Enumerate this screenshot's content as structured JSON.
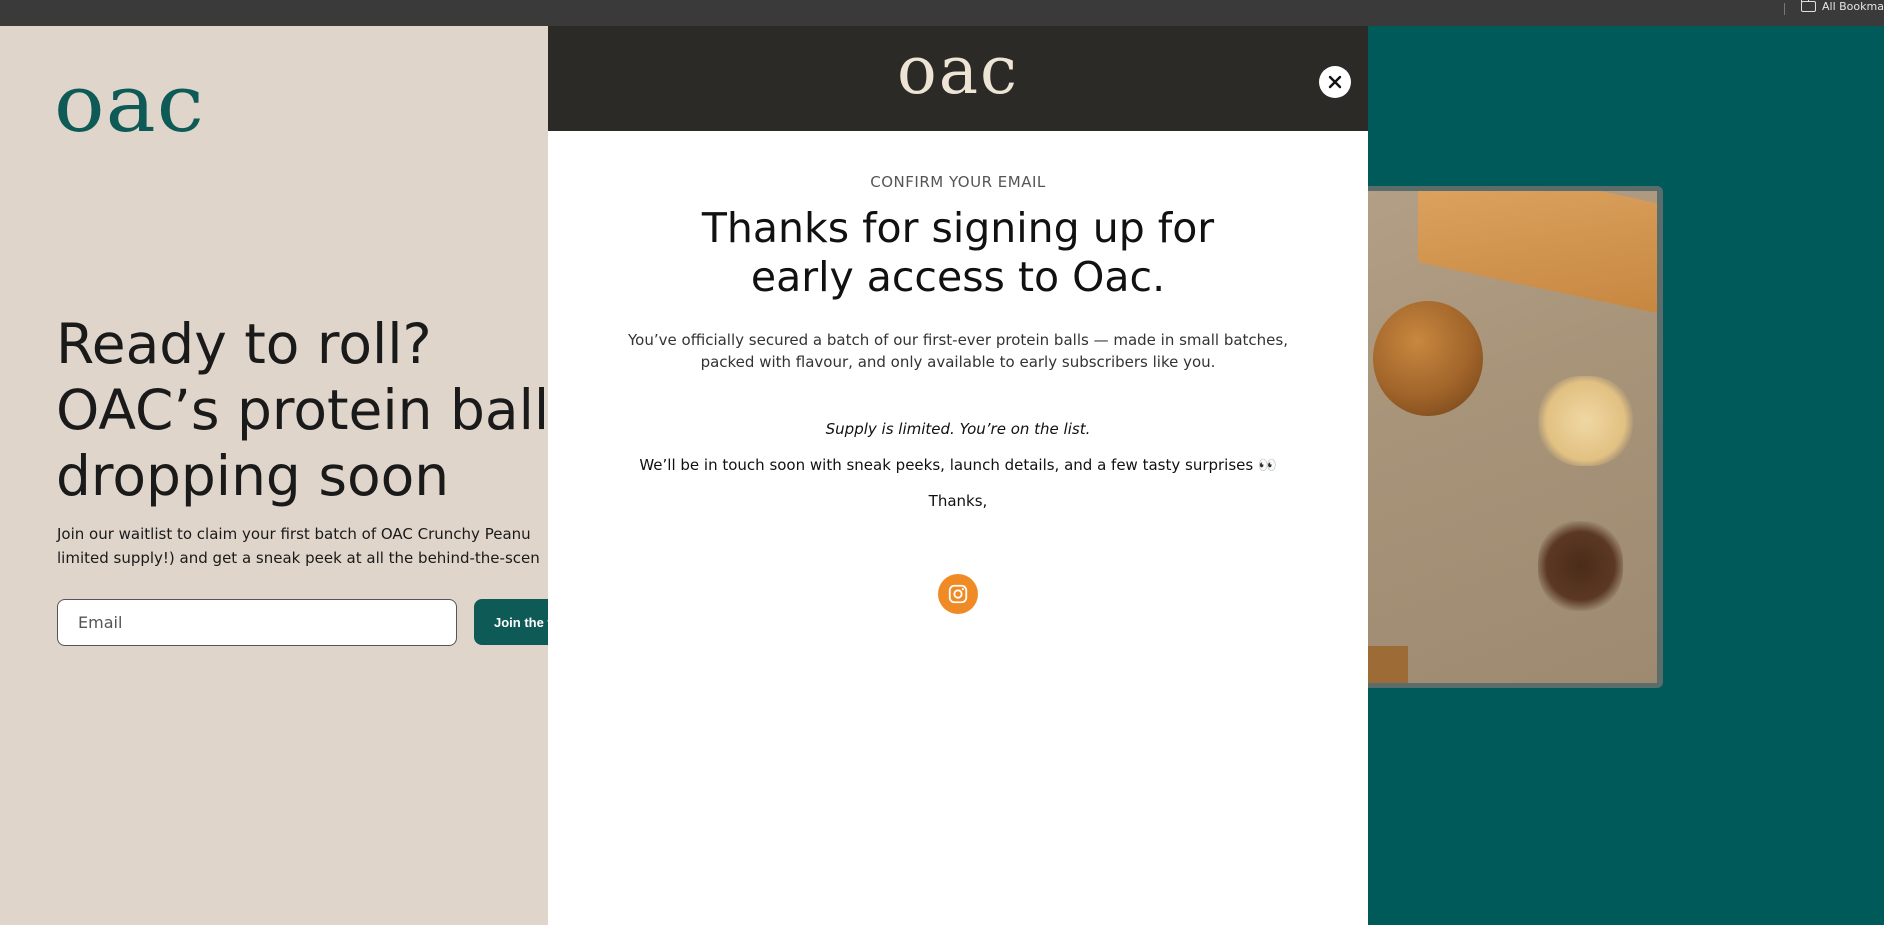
{
  "browser": {
    "bookmarks_label": "All Bookma"
  },
  "background": {
    "logo": "oac",
    "hero_title_lines": [
      "Ready to roll?",
      "OAC’s protein balls",
      "dropping soon"
    ],
    "hero_sub_lines": [
      "Join our waitlist to claim your first batch of OAC Crunchy Peanu",
      "limited supply!) and get a sneak peek at all the behind-the-scen"
    ],
    "email_placeholder": "Email",
    "join_label": "Join the w"
  },
  "modal": {
    "logo": "oac",
    "eyebrow": "CONFIRM YOUR EMAIL",
    "title_lines": [
      "Thanks for signing up for",
      "early access to Oac."
    ],
    "intro_lines": [
      "You’ve officially secured a batch of our first-ever protein balls — made in small batches,",
      "packed with flavour, and only available to early subscribers like you."
    ],
    "supply": "Supply is limited. You’re on the list.",
    "touch": "We’ll be in touch soon with sneak peeks, launch details, and a few tasty surprises 👀",
    "thanks": "Thanks,"
  },
  "colors": {
    "brand_teal": "#0e5a57",
    "modal_header": "#2c2a27",
    "instagram_orange": "#f08a24",
    "page_beige": "#dfd5cb"
  }
}
